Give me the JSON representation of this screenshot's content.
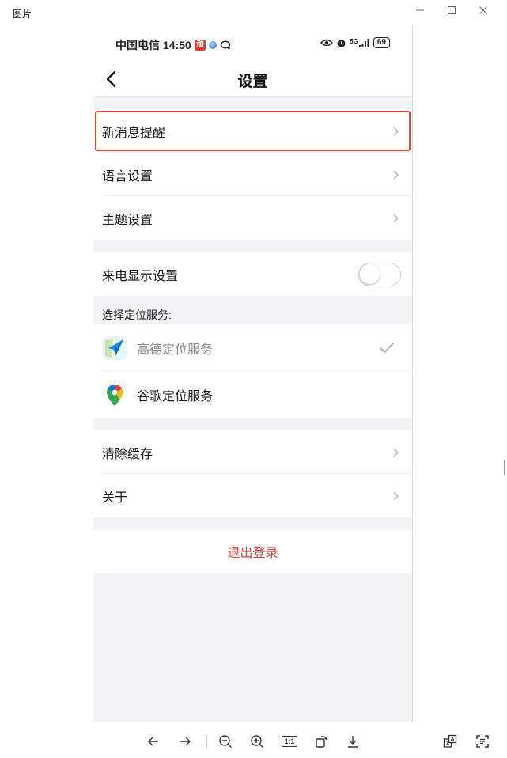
{
  "window": {
    "title": "图片"
  },
  "status_bar": {
    "carrier": "中国电信",
    "time": "14:50",
    "tao_badge": "淘",
    "network": "5G",
    "battery": "69"
  },
  "nav": {
    "title": "设置"
  },
  "settings": {
    "group1": [
      {
        "label": "新消息提醒",
        "highlighted": true
      },
      {
        "label": "语言设置"
      },
      {
        "label": "主题设置"
      }
    ],
    "caller_display": {
      "label": "来电显示设置",
      "enabled": false
    },
    "location_section_label": "选择定位服务:",
    "location_services": [
      {
        "label": "高德定位服务",
        "icon": "amap-icon",
        "selected": true
      },
      {
        "label": "谷歌定位服务",
        "icon": "google-maps-icon",
        "selected": false
      }
    ],
    "group3": [
      {
        "label": "清除缓存"
      },
      {
        "label": "关于"
      }
    ],
    "logout": "退出登录"
  },
  "toolbar": {
    "one_to_one": "1:1"
  },
  "colors": {
    "accent_red": "#d6453b",
    "highlight_border": "#e0453a",
    "page_bg": "#f4f4f6"
  }
}
